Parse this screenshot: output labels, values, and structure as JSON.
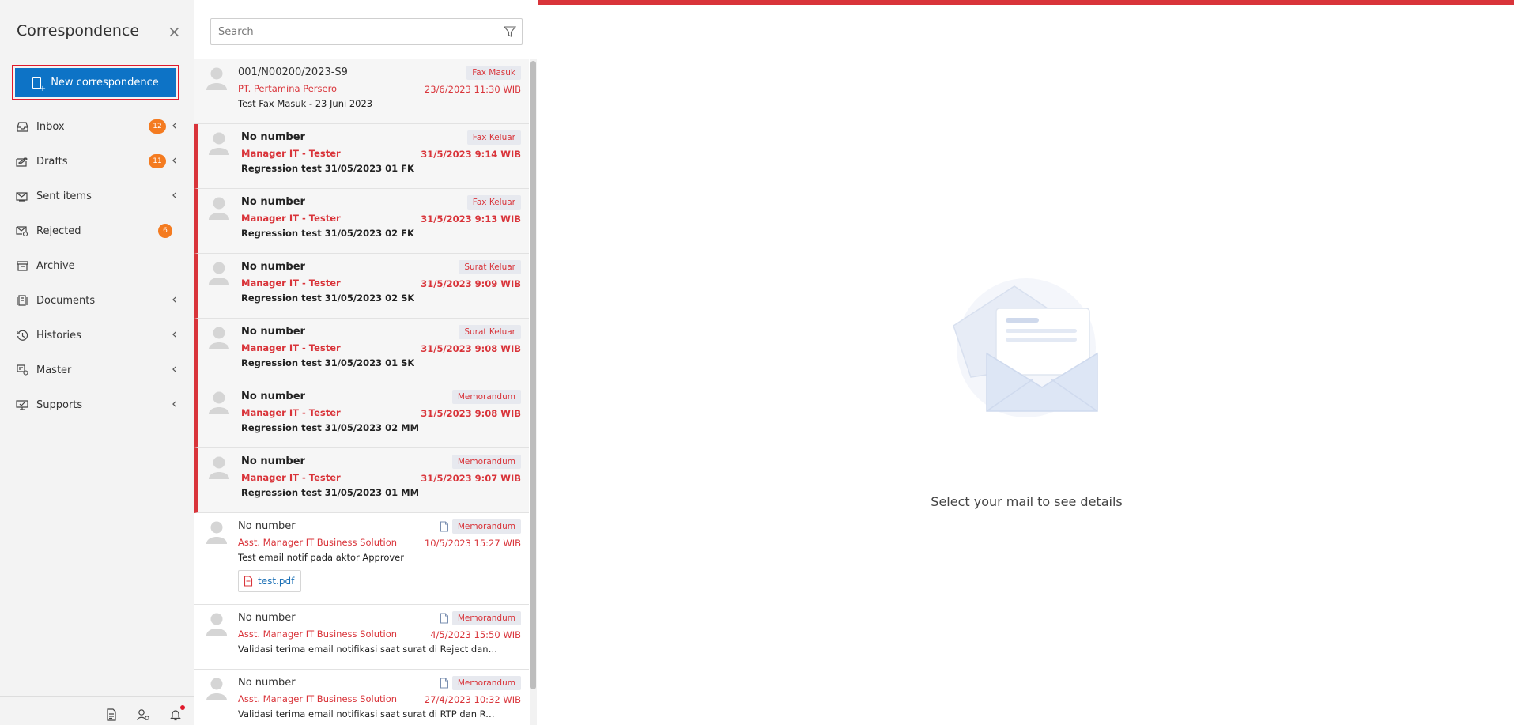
{
  "sidebar": {
    "title": "Correspondence",
    "new_button": "New correspondence",
    "items": [
      {
        "label": "Inbox",
        "badge": "12",
        "icon": "inbox-icon",
        "chevron": true
      },
      {
        "label": "Drafts",
        "badge": "11",
        "icon": "drafts-icon",
        "chevron": true
      },
      {
        "label": "Sent items",
        "badge": "",
        "icon": "sent-icon",
        "chevron": true
      },
      {
        "label": "Rejected",
        "badge": "6",
        "icon": "rejected-icon",
        "chevron": false
      },
      {
        "label": "Archive",
        "badge": "",
        "icon": "archive-icon",
        "chevron": false
      },
      {
        "label": "Documents",
        "badge": "",
        "icon": "documents-icon",
        "chevron": true
      },
      {
        "label": "Histories",
        "badge": "",
        "icon": "history-icon",
        "chevron": true
      },
      {
        "label": "Master",
        "badge": "",
        "icon": "master-icon",
        "chevron": true
      },
      {
        "label": "Supports",
        "badge": "",
        "icon": "supports-icon",
        "chevron": true
      }
    ]
  },
  "search": {
    "placeholder": "Search"
  },
  "mails": [
    {
      "number": "001/N00200/2023-S9",
      "sender": "PT. Pertamina Persero",
      "subject": "Test Fax Masuk - 23 Juni 2023",
      "type": "Fax Masuk",
      "date": "23/6/2023 11:30 WIB",
      "unread": false
    },
    {
      "number": "No number",
      "sender": "Manager IT - Tester",
      "subject": "Regression test 31/05/2023 01 FK",
      "type": "Fax Keluar",
      "date": "31/5/2023 9:14 WIB",
      "unread": true
    },
    {
      "number": "No number",
      "sender": "Manager IT - Tester",
      "subject": "Regression test 31/05/2023 02 FK",
      "type": "Fax Keluar",
      "date": "31/5/2023 9:13 WIB",
      "unread": true
    },
    {
      "number": "No number",
      "sender": "Manager IT - Tester",
      "subject": "Regression test 31/05/2023 02 SK",
      "type": "Surat Keluar",
      "date": "31/5/2023 9:09 WIB",
      "unread": true
    },
    {
      "number": "No number",
      "sender": "Manager IT - Tester",
      "subject": "Regression test 31/05/2023 01 SK",
      "type": "Surat Keluar",
      "date": "31/5/2023 9:08 WIB",
      "unread": true
    },
    {
      "number": "No number",
      "sender": "Manager IT - Tester",
      "subject": "Regression test 31/05/2023 02 MM",
      "type": "Memorandum",
      "date": "31/5/2023 9:08 WIB",
      "unread": true
    },
    {
      "number": "No number",
      "sender": "Manager IT - Tester",
      "subject": "Regression test 31/05/2023 01 MM",
      "type": "Memorandum",
      "date": "31/5/2023 9:07 WIB",
      "unread": true
    },
    {
      "number": "No number",
      "sender": "Asst. Manager IT Business Solution",
      "subject": "Test email notif pada aktor Approver",
      "type": "Memorandum",
      "date": "10/5/2023 15:27 WIB",
      "unread": false,
      "attachment": "test.pdf"
    },
    {
      "number": "No number",
      "sender": "Asst. Manager IT Business Solution",
      "subject": "Validasi terima email notifikasi saat surat di Reject dan cek...",
      "type": "Memorandum",
      "date": "4/5/2023 15:50 WIB",
      "unread": false
    },
    {
      "number": "No number",
      "sender": "Asst. Manager IT Business Solution",
      "subject": "Validasi terima email notifikasi saat surat di RTP dan Reject",
      "type": "Memorandum",
      "date": "27/4/2023 10:32 WIB",
      "unread": false
    }
  ],
  "detail": {
    "empty_text": "Select your mail to see details"
  },
  "colors": {
    "accent": "#0d73c6",
    "red": "#d9343a",
    "badge": "#f47b20"
  }
}
